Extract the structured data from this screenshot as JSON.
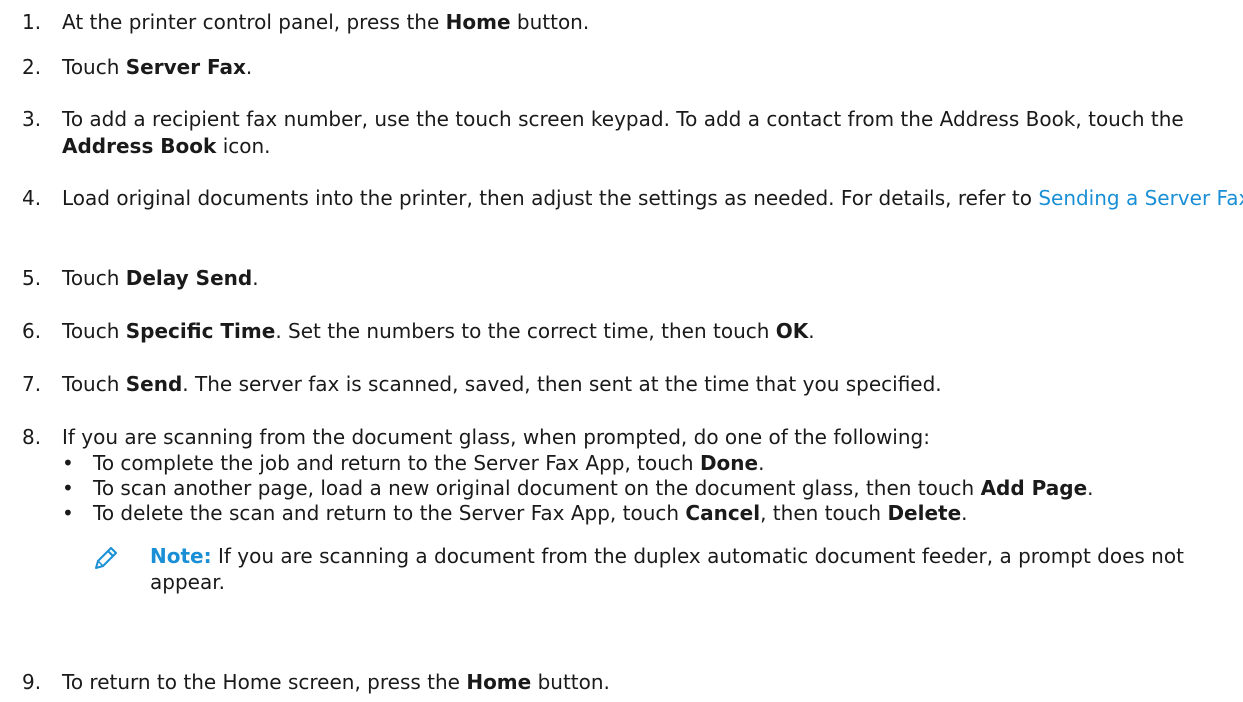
{
  "steps": [
    {
      "num": "1.",
      "parts": [
        "At the printer control panel, press the ",
        "Home",
        " button."
      ]
    },
    {
      "num": "2.",
      "parts": [
        "Touch ",
        "Server Fax",
        "."
      ]
    },
    {
      "num": "3.",
      "parts": [
        "To add a recipient fax number, use the touch screen keypad. To add a contact from the Address Book, touch the ",
        "Address Book",
        " icon."
      ]
    },
    {
      "num": "4.",
      "parts": [
        "Load original documents into the printer, then adjust the settings as needed. For details, refer to ",
        "Sending a Server Fax",
        "."
      ]
    },
    {
      "num": "5.",
      "parts": [
        "Touch ",
        "Delay Send",
        "."
      ]
    },
    {
      "num": "6.",
      "parts": [
        "Touch ",
        "Specific Time",
        ". Set the numbers to the correct time, then touch ",
        "OK",
        "."
      ]
    },
    {
      "num": "7.",
      "parts": [
        "Touch ",
        "Send",
        ". The server fax is scanned, saved, then sent at the time that you specified."
      ]
    },
    {
      "num": "8.",
      "parts": [
        "If you are scanning from the document glass, when prompted, do one of the following:"
      ]
    },
    {
      "num": "9.",
      "parts": [
        "To return to the Home screen, press the ",
        "Home",
        " button."
      ]
    }
  ],
  "bullets": [
    {
      "parts": [
        "To complete the job and return to the Server Fax App, touch ",
        "Done",
        "."
      ]
    },
    {
      "parts": [
        "To scan another page, load a new original document on the document glass, then touch ",
        "Add Page",
        "."
      ]
    },
    {
      "parts": [
        "To delete the scan and return to the Server Fax App, touch ",
        "Cancel",
        ", then touch ",
        "Delete",
        "."
      ]
    }
  ],
  "bullet_symbol": "•",
  "note": {
    "label": "Note:",
    "text": " If you are scanning a document from the duplex automatic document feeder, a prompt does not appear.",
    "icon": "pencil-icon"
  },
  "colors": {
    "link": "#1a8fd6",
    "text": "#1a1a1a"
  }
}
